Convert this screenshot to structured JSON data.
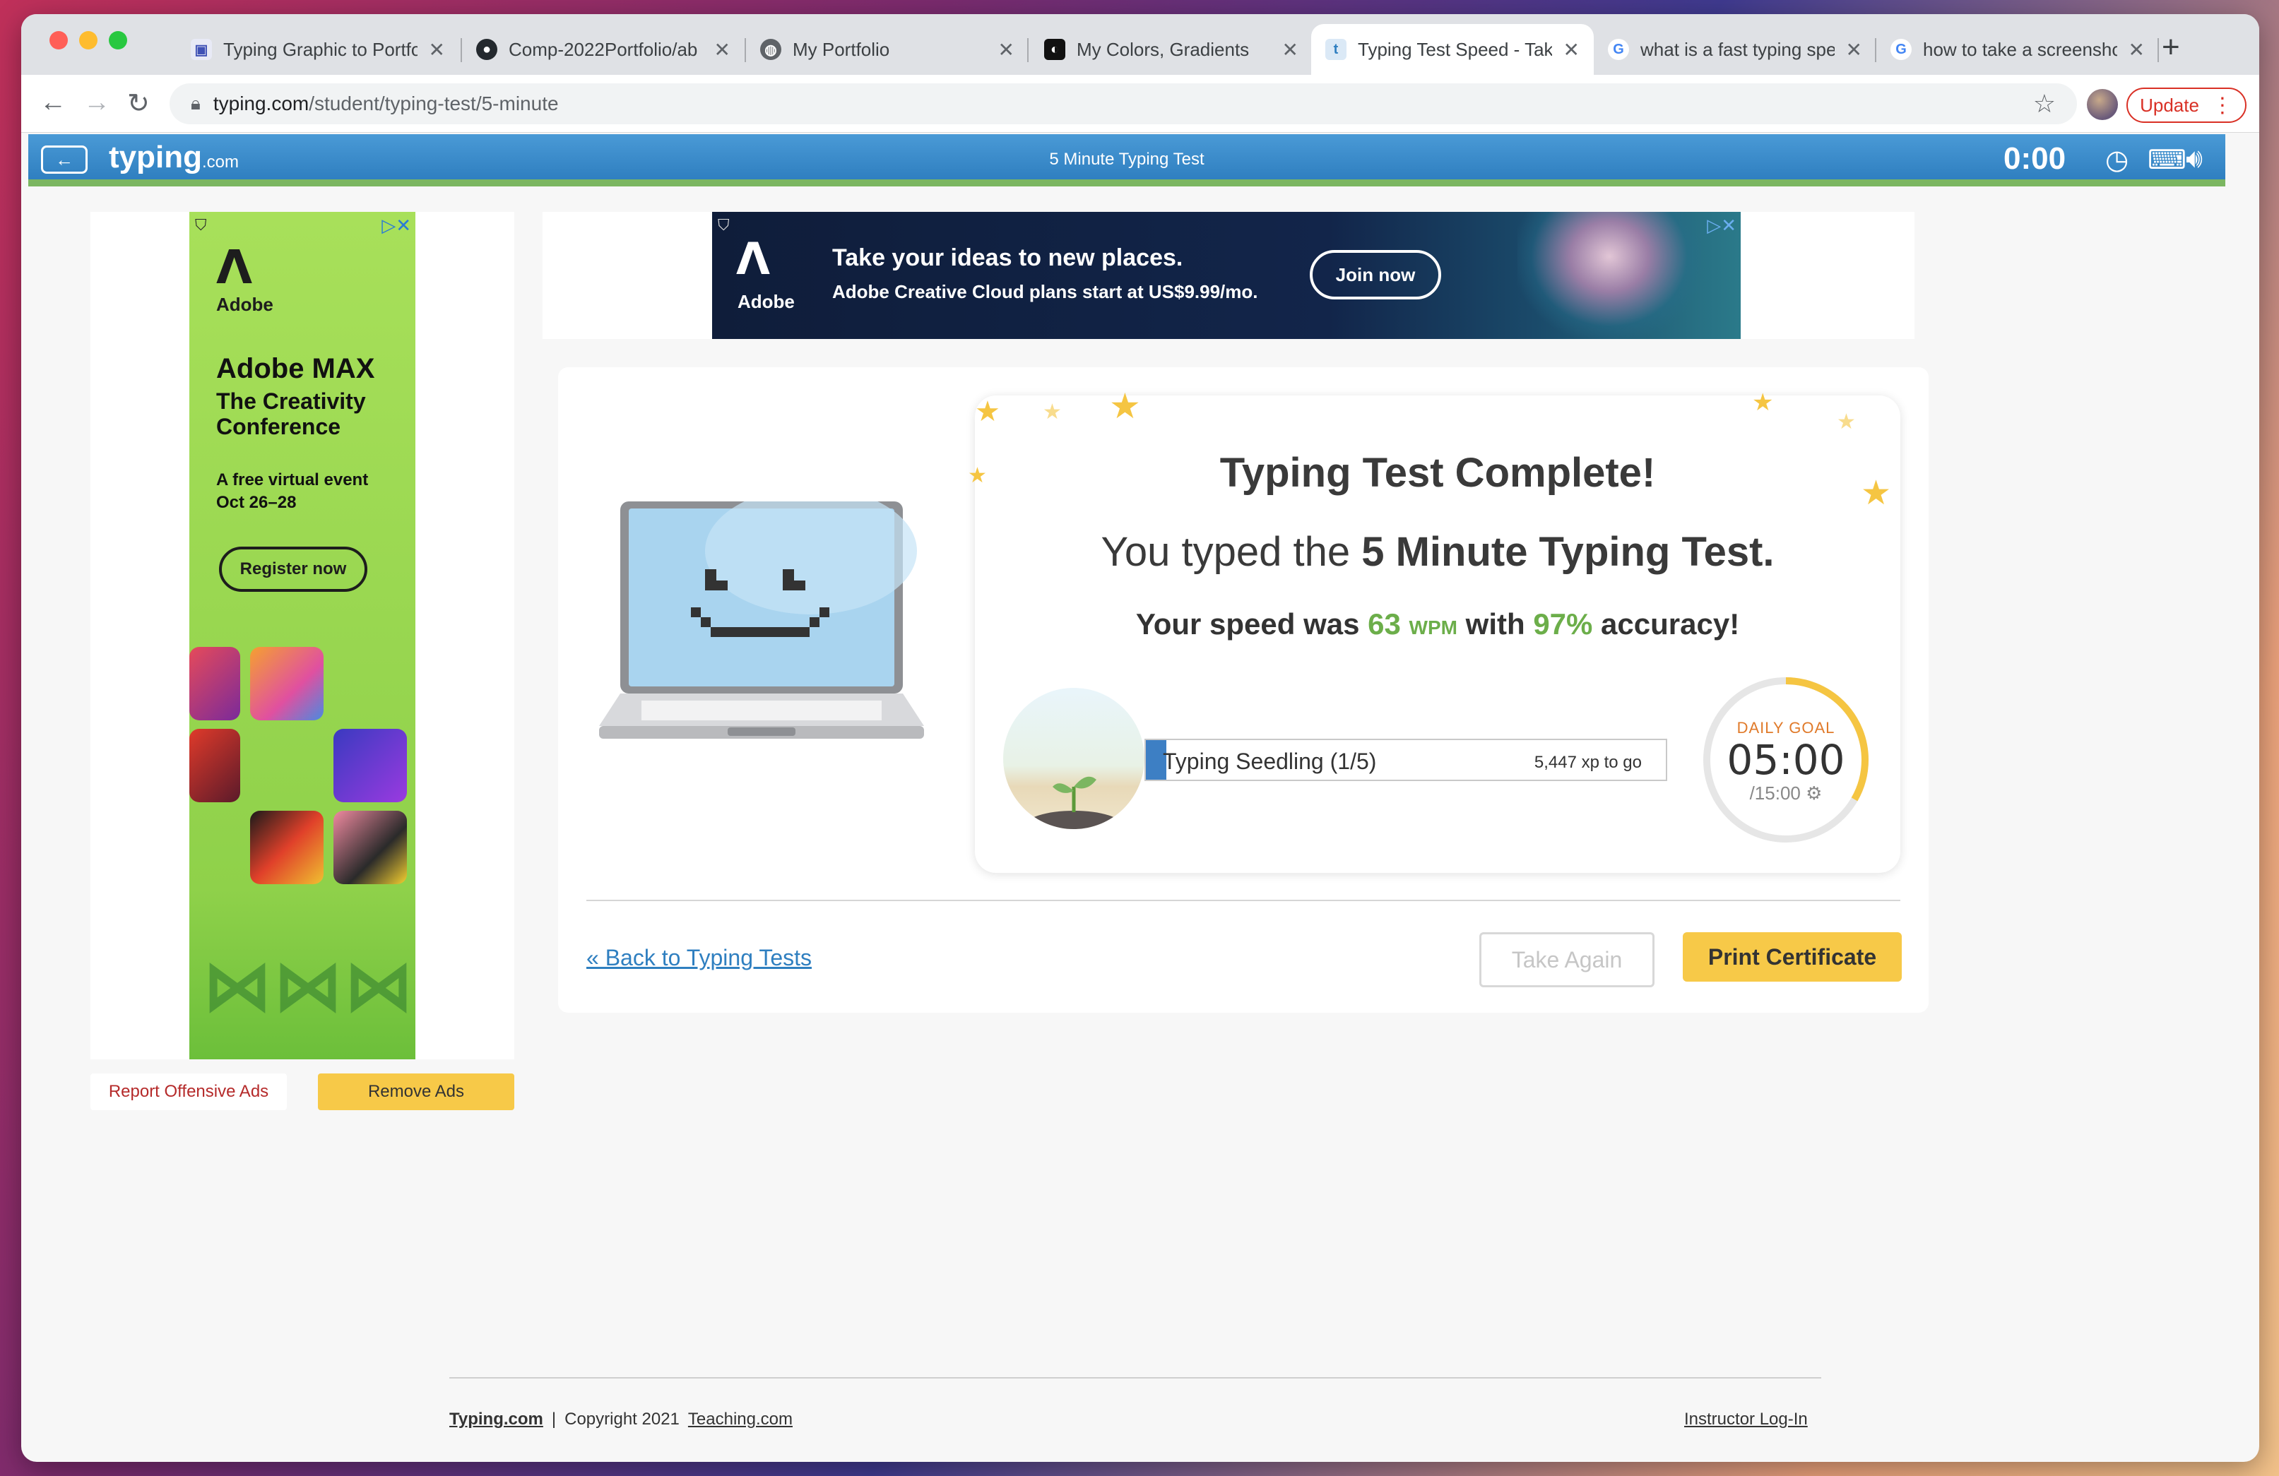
{
  "browser": {
    "tabs": [
      {
        "label": "Typing Graphic to Portfo",
        "icon": "image-icon"
      },
      {
        "label": "Comp-2022Portfolio/ab",
        "icon": "github-icon"
      },
      {
        "label": "My Portfolio",
        "icon": "globe-icon"
      },
      {
        "label": "My Colors, Gradients",
        "icon": "colors-icon"
      },
      {
        "label": "Typing Test Speed - Tak",
        "icon": "typing-icon",
        "active": true
      },
      {
        "label": "what is a fast typing spe",
        "icon": "google-icon"
      },
      {
        "label": "how to take a screensho",
        "icon": "google-icon"
      }
    ],
    "url_host": "typing.com",
    "url_path": "/student/typing-test/5-minute",
    "update_label": "Update"
  },
  "site": {
    "logo": "typing",
    "logo_suffix": ".com",
    "page_title": "5 Minute Typing Test",
    "timer": "0:00"
  },
  "side_ad": {
    "brand": "Adobe",
    "title": "Adobe MAX",
    "subtitle": "The Creativity Conference",
    "event": "A free virtual event Oct 26–28",
    "cta": "Register now"
  },
  "top_ad": {
    "brand": "Adobe",
    "headline": "Take your ideas to new places.",
    "sub": "Adobe Creative Cloud plans start at US$9.99/mo.",
    "cta": "Join now"
  },
  "ad_buttons": {
    "report": "Report Offensive Ads",
    "remove": "Remove Ads"
  },
  "result": {
    "heading": "Typing Test Complete!",
    "typed_prefix": "You typed the",
    "typed_test": "5 Minute Typing Test.",
    "speed_prefix": "Your speed was",
    "wpm_value": "63",
    "wpm_unit": "WPM",
    "speed_mid": "with",
    "accuracy": "97%",
    "speed_suffix": "accuracy!",
    "level_label": "Typing Seedling (1/5)",
    "level_progress": 0.04,
    "xp_to_go": "5,447 xp to go",
    "goal_label": "DAILY GOAL",
    "goal_time": "05:00",
    "goal_total": "/15:00",
    "goal_progress": 0.333
  },
  "actions": {
    "back": "« Back to Typing Tests",
    "take_again": "Take Again",
    "print": "Print Certificate"
  },
  "footer": {
    "site": "Typing.com",
    "copyright": "Copyright 2021",
    "teaching": "Teaching.com",
    "instructor": "Instructor Log-In"
  },
  "colors": {
    "header_blue": "#2f7fc0",
    "accent_green": "#6cae4a",
    "button_yellow": "#f7c948",
    "goal_orange": "#e07a2a"
  }
}
